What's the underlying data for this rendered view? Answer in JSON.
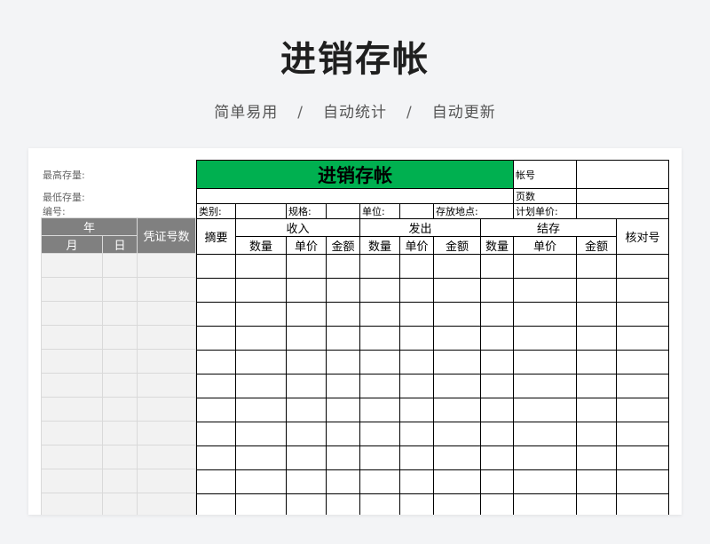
{
  "page": {
    "title": "进销存帐",
    "subtitle_items": [
      "简单易用",
      "自动统计",
      "自动更新"
    ],
    "separator": "/"
  },
  "sheet": {
    "side_labels": {
      "max_stock": "最高存量:",
      "min_stock": "最低存量:",
      "code": "编号:"
    },
    "left_headers": {
      "year": "年",
      "month": "月",
      "day": "日",
      "voucher": "凭证号数"
    },
    "ledger_title": "进销存帐",
    "account_no_label": "帐号",
    "page_count_label": "页数",
    "info_row": {
      "category": "类别:",
      "spec": "规格:",
      "unit": "单位:",
      "location": "存放地点:",
      "plan_price": "计划单价:"
    },
    "headers": {
      "summary": "摘要",
      "income": "收入",
      "issue": "发出",
      "balance": "结存",
      "check_no": "核对号",
      "qty": "数量",
      "unit_price": "单价",
      "amount": "金额"
    }
  },
  "colors": {
    "title_bar": "#00b050",
    "left_header": "#808080",
    "left_body": "#f2f2f2",
    "background": "#f3f4f6"
  }
}
